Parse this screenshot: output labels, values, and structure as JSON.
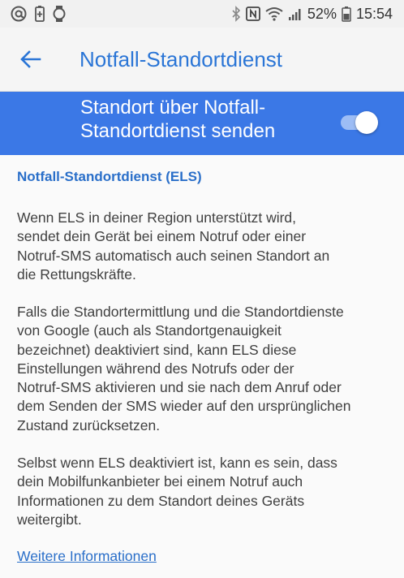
{
  "status_bar": {
    "icons": [
      "at-icon",
      "battery-saver-icon",
      "watch-icon",
      "bluetooth-icon",
      "nfc-icon",
      "wifi-icon",
      "signal-icon",
      "battery-icon"
    ],
    "battery": "52%",
    "time": "15:54"
  },
  "app_bar": {
    "title": "Notfall-Standortdienst",
    "accent": "#2a75d6"
  },
  "toggle_row": {
    "label": "Standort über Notfall-Standortdienst senden",
    "state": "on",
    "background": "#3b78e6"
  },
  "dialog": {
    "title": "Notfall-Standortdienst (ELS)",
    "paragraphs": [
      "Wenn ELS in deiner Region unterstützt wird,\nsendet dein Gerät bei einem Notruf oder einer\nNotruf-SMS automatisch auch seinen Standort an\ndie Rettungskräfte.",
      "Falls die Standortermittlung und die Standortdienste\nvon Google (auch als Standortgenauigkeit\nbezeichnet) deaktiviert sind, kann ELS diese\nEinstellungen während des Notrufs oder der\nNotruf-SMS aktivieren und sie nach dem Anruf oder\ndem Senden der SMS wieder auf den ursprünglichen\nZustand zurücksetzen.",
      "Selbst wenn ELS deaktiviert ist, kann es sein, dass\ndein Mobilfunkanbieter bei einem Notruf auch\nInformationen zu dem Standort deines Geräts\nweitergibt."
    ],
    "link": "Weitere Informationen"
  }
}
